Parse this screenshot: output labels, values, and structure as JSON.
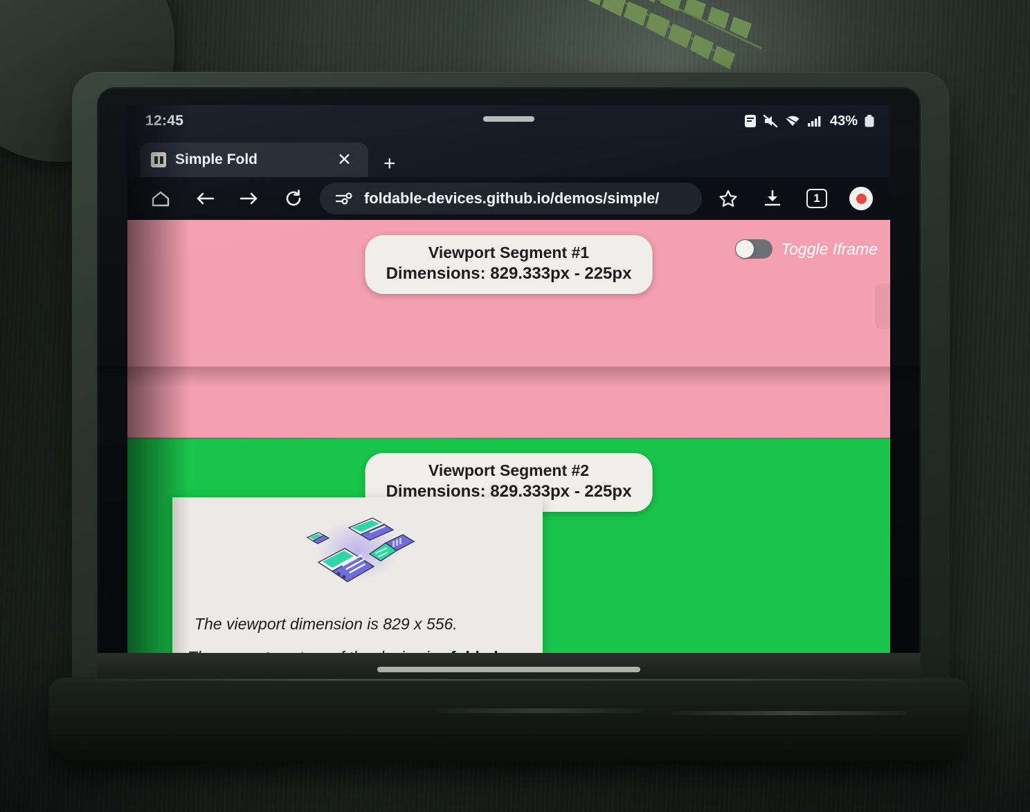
{
  "statusbar": {
    "time": "12:45",
    "battery_percent": "43%",
    "icons": [
      "app-notification-icon",
      "vibrate-off-icon",
      "wifi-icon",
      "cellular-signal-icon",
      "battery-icon"
    ]
  },
  "browser": {
    "tab": {
      "title": "Simple Fold",
      "favicon": "simple-fold-favicon",
      "close_label": "✕",
      "new_tab_label": "+"
    },
    "toolbar": {
      "home_icon": "home-icon",
      "back_icon": "back-arrow-icon",
      "forward_icon": "forward-arrow-icon",
      "reload_icon": "reload-icon",
      "site_settings_icon": "tune-icon",
      "url": "foldable-devices.github.io/demos/simple/",
      "bookmark_icon": "star-icon",
      "download_icon": "download-icon",
      "tab_count": "1",
      "profile_icon": "profile-avatar-icon"
    }
  },
  "page": {
    "segments": [
      {
        "name": "Viewport Segment #1",
        "dimensions": "Dimensions: 829.333px - 225px",
        "color": "#f4a0b0"
      },
      {
        "name": "Viewport Segment #2",
        "dimensions": "Dimensions: 829.333px - 225px",
        "color": "#18c44a"
      }
    ],
    "toggle": {
      "label": "Toggle Iframe",
      "state": "off"
    },
    "card": {
      "illustration": "foldable-devices-illustration",
      "viewport_line": "The viewport dimension is 829 x 556.",
      "posture_prefix": "The current posture of the device is : ",
      "posture_value": "folded"
    }
  },
  "colors": {
    "segment_1": "#f4a0b0",
    "segment_2": "#18c44a",
    "card_bg": "#eceae6",
    "status_bar": "#131822",
    "toolbar": "#0c1016",
    "omnibox": "#20242c"
  }
}
